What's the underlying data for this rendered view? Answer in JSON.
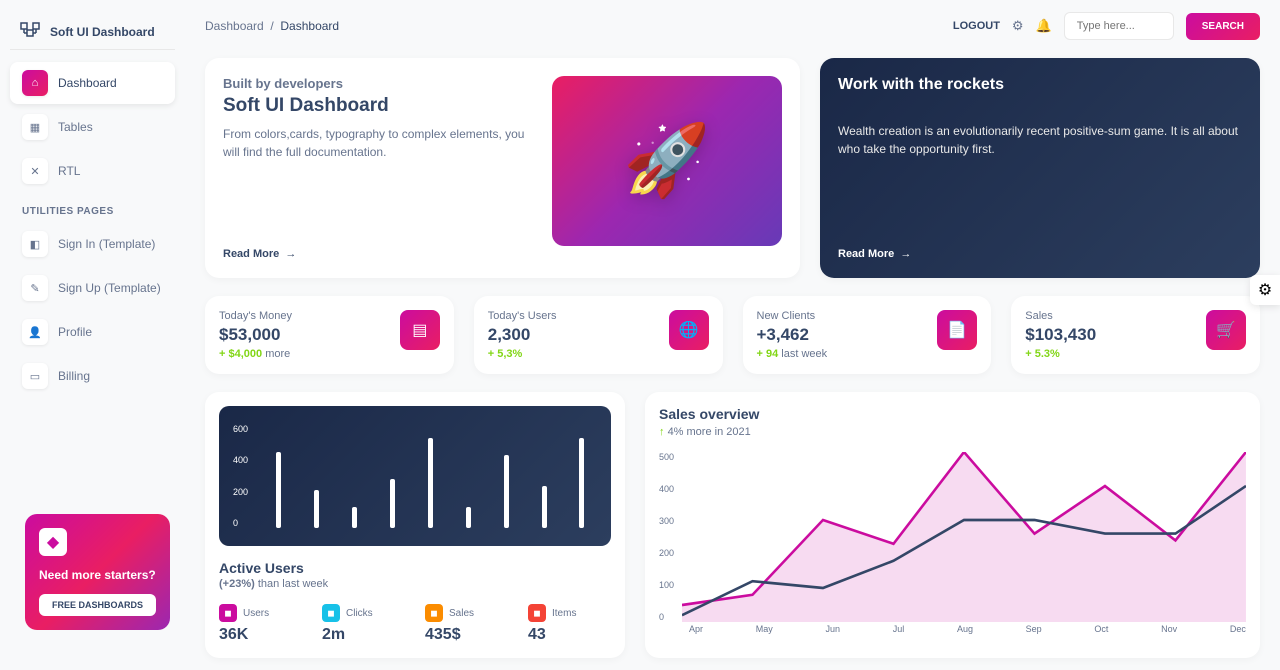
{
  "brand": "Soft UI Dashboard",
  "breadcrumb": {
    "root": "Dashboard",
    "current": "Dashboard"
  },
  "topbar": {
    "logout": "LOGOUT",
    "search_placeholder": "Type here...",
    "search_btn": "SEARCH"
  },
  "sidebar": {
    "items": [
      {
        "label": "Dashboard"
      },
      {
        "label": "Tables"
      },
      {
        "label": "RTL"
      }
    ],
    "section": "UTILITIES PAGES",
    "utils": [
      {
        "label": "Sign In (Template)"
      },
      {
        "label": "Sign Up (Template)"
      },
      {
        "label": "Profile"
      },
      {
        "label": "Billing"
      }
    ]
  },
  "promo": {
    "text": "Need more starters?",
    "btn": "FREE DASHBOARDS"
  },
  "hero1": {
    "subtitle": "Built by developers",
    "title": "Soft UI Dashboard",
    "desc": "From colors,cards, typography to complex elements, you will find the full documentation.",
    "link": "Read More"
  },
  "hero2": {
    "title": "Work with the rockets",
    "desc": "Wealth creation is an evolutionarily recent positive-sum game. It is all about who take the opportunity first.",
    "link": "Read More"
  },
  "stats": [
    {
      "label": "Today's Money",
      "value": "$53,000",
      "change": "+ $4,000",
      "suffix": "more"
    },
    {
      "label": "Today's Users",
      "value": "2,300",
      "change": "+ 5,3%",
      "suffix": ""
    },
    {
      "label": "New Clients",
      "value": "+3,462",
      "change": "+ 94",
      "suffix": "last week"
    },
    {
      "label": "Sales",
      "value": "$103,430",
      "change": "+ 5.3%",
      "suffix": ""
    }
  ],
  "chart_data": [
    {
      "type": "bar",
      "title": "Active Users",
      "subtitle_change": "(+23%)",
      "subtitle_rest": " than last week",
      "y_ticks": [
        "600",
        "400",
        "200",
        "0"
      ],
      "values": [
        440,
        220,
        120,
        280,
        520,
        120,
        420,
        240,
        520
      ],
      "ylim": [
        0,
        600
      ],
      "mini_stats": [
        {
          "label": "Users",
          "value": "36K",
          "color": "#cb0c9f"
        },
        {
          "label": "Clicks",
          "value": "2m",
          "color": "#17c1e8"
        },
        {
          "label": "Sales",
          "value": "435$",
          "color": "#fb8c00"
        },
        {
          "label": "Items",
          "value": "43",
          "color": "#f44336"
        }
      ]
    },
    {
      "type": "line",
      "title": "Sales overview",
      "subtitle_arrow": "↑",
      "subtitle_text": "4% more in 2021",
      "y_ticks": [
        "500",
        "400",
        "300",
        "200",
        "100",
        "0"
      ],
      "x_labels": [
        "Apr",
        "May",
        "Jun",
        "Jul",
        "Aug",
        "Sep",
        "Oct",
        "Nov",
        "Dec"
      ],
      "series": [
        {
          "name": "pink",
          "color": "#cb0c9f",
          "values": [
            50,
            80,
            300,
            230,
            500,
            260,
            400,
            240,
            500
          ]
        },
        {
          "name": "navy",
          "color": "#344767",
          "values": [
            20,
            120,
            100,
            180,
            300,
            300,
            260,
            260,
            400
          ]
        }
      ],
      "ylim": [
        0,
        500
      ]
    }
  ]
}
